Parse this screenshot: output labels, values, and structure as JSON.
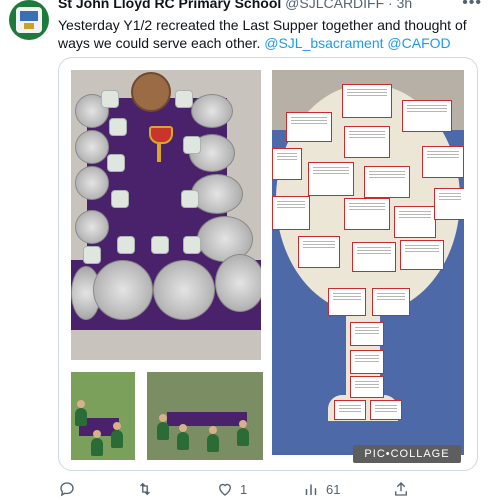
{
  "tweet": {
    "author_name": "St John Lloyd RC Primary School",
    "author_handle": "@SJLCARDIFF",
    "time": "· 3h",
    "text_plain": "Yesterday Y1/2 recreated the Last Supper together and thought of ways we could serve each other.",
    "mention_1": "@SJL_bsacrament",
    "mention_2": "@CAFOD"
  },
  "media": {
    "watermark": "PIC•COLLAGE"
  },
  "actions": {
    "reply_count": "",
    "retweet_count": "",
    "like_count": "1",
    "views_count": "61"
  },
  "icons": [
    "avatar-logo",
    "more-icon",
    "reply-icon",
    "retweet-icon",
    "like-icon",
    "views-icon",
    "share-icon"
  ]
}
